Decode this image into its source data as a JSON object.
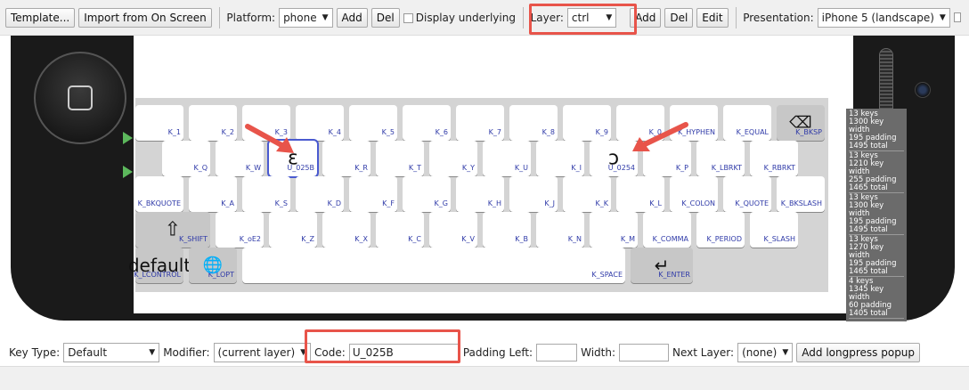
{
  "toolbar": {
    "template": "Template...",
    "import": "Import from On Screen",
    "platform_label": "Platform:",
    "platform_value": "phone",
    "add": "Add",
    "del": "Del",
    "display_underlying": "Display underlying",
    "layer_label": "Layer:",
    "layer_value": "ctrl",
    "edit": "Edit",
    "presentation_label": "Presentation:",
    "presentation_value": "iPhone 5 (landscape)"
  },
  "rows": [
    {
      "keys": [
        {
          "label": "K_1"
        },
        {
          "label": "K_2"
        },
        {
          "label": "K_3"
        },
        {
          "label": "K_4"
        },
        {
          "label": "K_5"
        },
        {
          "label": "K_6"
        },
        {
          "label": "K_7"
        },
        {
          "label": "K_8"
        },
        {
          "label": "K_9"
        },
        {
          "label": "K_0"
        },
        {
          "label": "K_HYPHEN"
        },
        {
          "label": "K_EQUAL"
        },
        {
          "label": "K_BKSP"
        }
      ]
    },
    {
      "keys": [
        {
          "label": "K_Q"
        },
        {
          "label": "K_W"
        },
        {
          "label": "U_025B",
          "glyph": "ɛ"
        },
        {
          "label": "K_R"
        },
        {
          "label": "K_T"
        },
        {
          "label": "K_Y"
        },
        {
          "label": "K_U"
        },
        {
          "label": "K_I"
        },
        {
          "label": "U_0254",
          "glyph": "ɔ"
        },
        {
          "label": "K_P"
        },
        {
          "label": "K_LBRKT"
        },
        {
          "label": "K_RBRKT"
        }
      ]
    },
    {
      "keys": [
        {
          "label": "K_BKQUOTE"
        },
        {
          "label": "K_A"
        },
        {
          "label": "K_S"
        },
        {
          "label": "K_D"
        },
        {
          "label": "K_F"
        },
        {
          "label": "K_G"
        },
        {
          "label": "K_H"
        },
        {
          "label": "K_J"
        },
        {
          "label": "K_K"
        },
        {
          "label": "K_L"
        },
        {
          "label": "K_COLON"
        },
        {
          "label": "K_QUOTE"
        },
        {
          "label": "K_BKSLASH"
        }
      ]
    },
    {
      "keys": [
        {
          "label": "K_SHIFT"
        },
        {
          "label": "K_oE2"
        },
        {
          "label": "K_Z"
        },
        {
          "label": "K_X"
        },
        {
          "label": "K_C"
        },
        {
          "label": "K_V"
        },
        {
          "label": "K_B"
        },
        {
          "label": "K_N"
        },
        {
          "label": "K_M"
        },
        {
          "label": "K_COMMA"
        },
        {
          "label": "K_PERIOD"
        },
        {
          "label": "K_SLASH"
        }
      ]
    },
    {
      "keys": [
        {
          "label": "K_LCONTROL",
          "glyph": "default"
        },
        {
          "label": "K_LOPT"
        },
        {
          "label": "K_SPACE"
        },
        {
          "label": "K_ENTER"
        }
      ]
    }
  ],
  "stats": [
    [
      "13 keys",
      "1300 key width",
      "195 padding",
      "1495 total"
    ],
    [
      "13 keys",
      "1210 key width",
      "255 padding",
      "1465 total"
    ],
    [
      "13 keys",
      "1300 key width",
      "195 padding",
      "1495 total"
    ],
    [
      "13 keys",
      "1270 key width",
      "195 padding",
      "1465 total"
    ],
    [
      "4 keys",
      "1345 key width",
      "60 padding",
      "1405 total"
    ]
  ],
  "bottom": {
    "key_type_label": "Key Type:",
    "key_type_value": "Default",
    "modifier_label": "Modifier:",
    "modifier_value": "(current layer)",
    "code_label": "Code:",
    "code_value": "U_025B",
    "padding_label": "Padding Left:",
    "width_label": "Width:",
    "next_layer_label": "Next Layer:",
    "next_layer_value": "(none)",
    "add_longpress": "Add longpress popup"
  },
  "colors": {
    "highlight": "#e8544a",
    "key_label": "#2f3aa8",
    "marker": "#5cb85c"
  }
}
